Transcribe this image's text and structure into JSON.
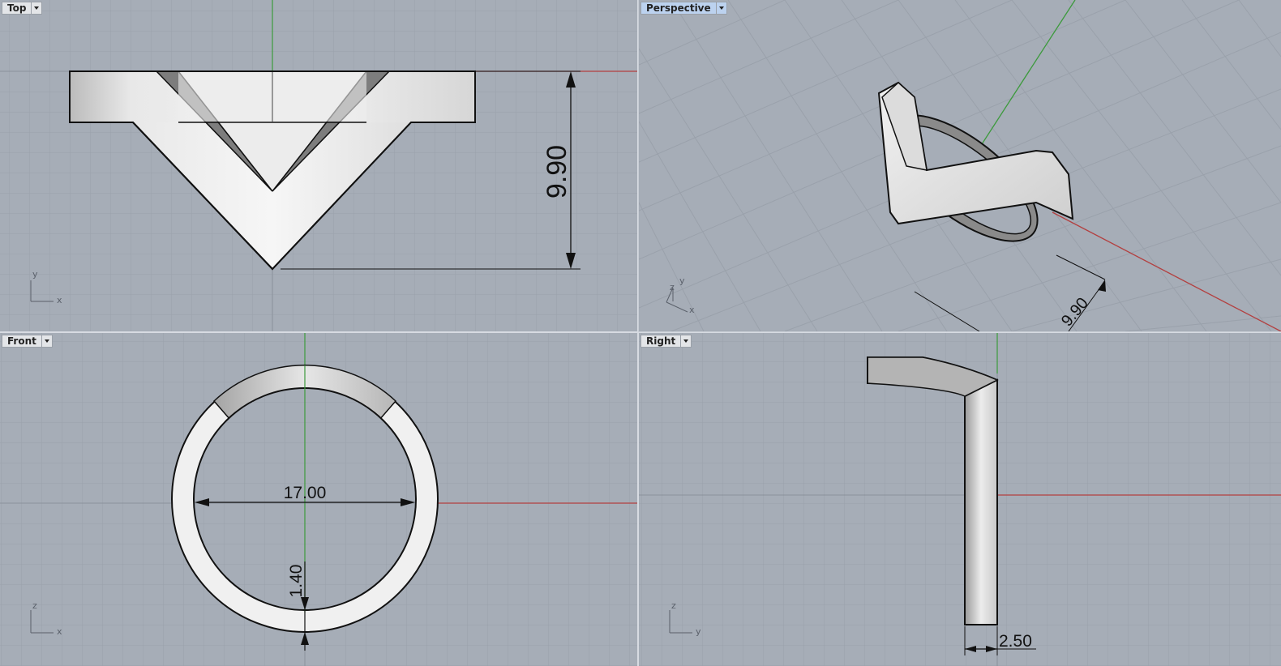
{
  "viewports": {
    "top": {
      "title": "Top",
      "dimension": "9.90",
      "axes": [
        "y",
        "x"
      ]
    },
    "perspective": {
      "title": "Perspective",
      "dimension": "9.90",
      "axes": [
        "z",
        "y",
        "x"
      ]
    },
    "front": {
      "title": "Front",
      "dimension_width": "17.00",
      "dimension_thickness": "1.40",
      "axes": [
        "z",
        "x"
      ]
    },
    "right": {
      "title": "Right",
      "dimension": "2.50",
      "axes": [
        "z",
        "y"
      ]
    }
  },
  "colors": {
    "viewport_bg": "#a6adb7",
    "grid_minor": "#9aa1ab",
    "grid_major": "#8a919b",
    "x_axis": "#b34040",
    "y_axis": "#3c9a3c",
    "active_tab": "#bcd2ef"
  },
  "icons": [
    "viewport-menu-arrow-icon",
    "axis-widget-icon"
  ]
}
